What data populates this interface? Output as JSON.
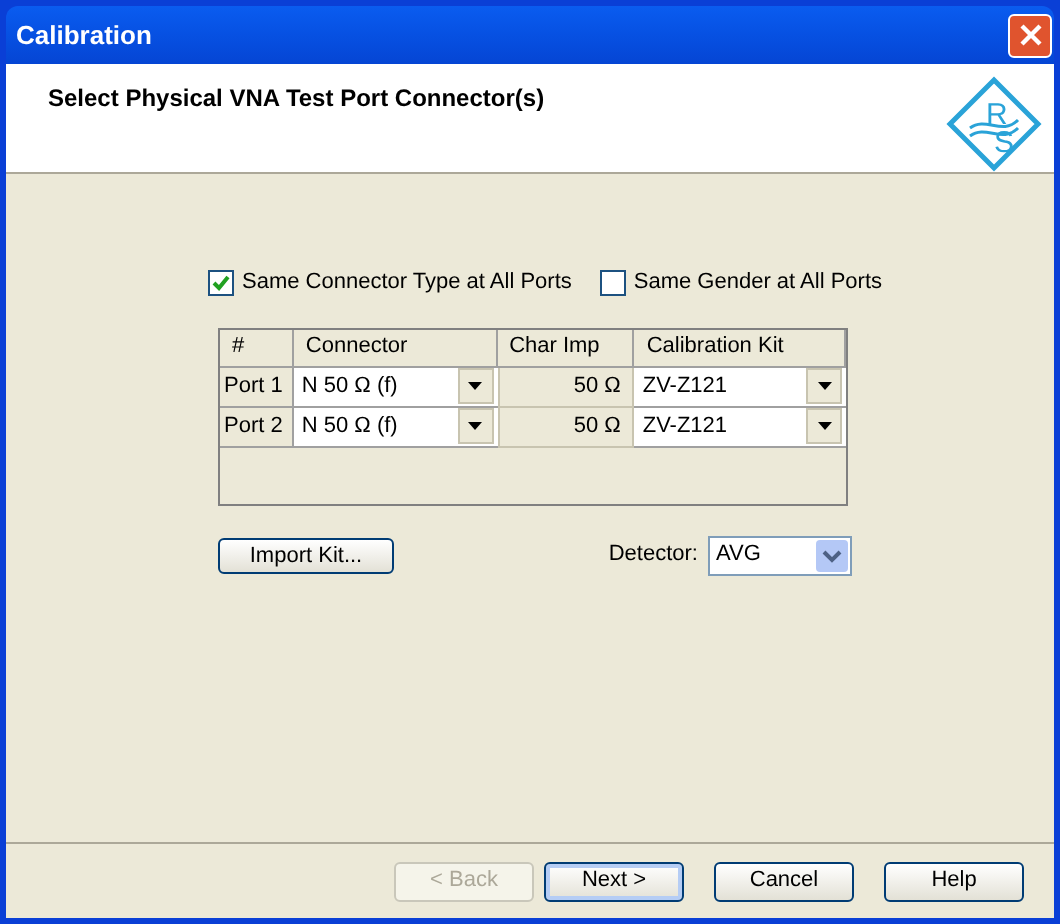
{
  "window": {
    "title": "Calibration"
  },
  "header": {
    "title": "Select Physical VNA Test Port Connector(s)",
    "logo_letters": [
      "R",
      "S"
    ]
  },
  "options": [
    {
      "label": "Same Connector Type at All Ports",
      "checked": true
    },
    {
      "label": "Same Gender at All Ports",
      "checked": false
    }
  ],
  "table": {
    "columns": [
      "#",
      "Connector",
      "Char Imp",
      "Calibration Kit"
    ],
    "rows": [
      {
        "port": "Port 1",
        "connector": "N 50 Ω (f)",
        "char_imp": "50 Ω",
        "kit": "ZV-Z121"
      },
      {
        "port": "Port 2",
        "connector": "N 50 Ω (f)",
        "char_imp": "50 Ω",
        "kit": "ZV-Z121"
      }
    ]
  },
  "import_button": "Import Kit...",
  "detector": {
    "label": "Detector:",
    "value": "AVG"
  },
  "buttons": [
    {
      "label": "< Back",
      "disabled": true,
      "selected": false
    },
    {
      "label": "Next >",
      "disabled": false,
      "selected": true
    },
    {
      "label": "Cancel",
      "disabled": false,
      "selected": false
    },
    {
      "label": "Help",
      "disabled": false,
      "selected": false
    }
  ]
}
